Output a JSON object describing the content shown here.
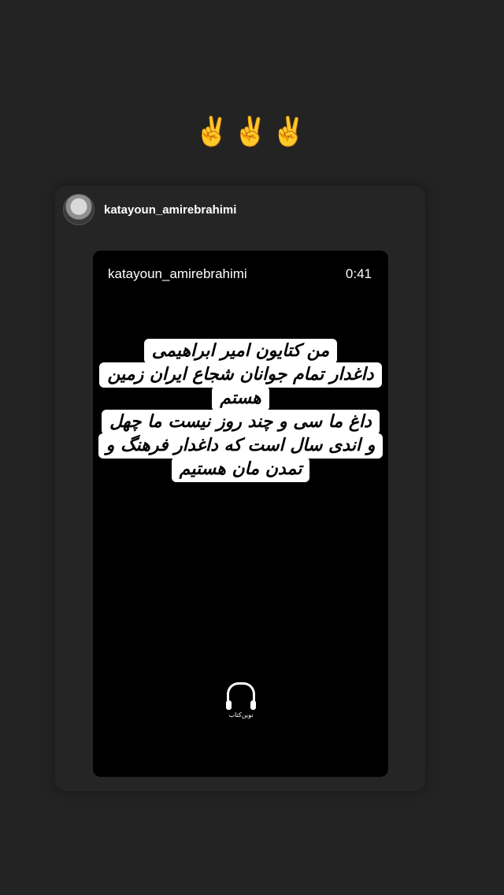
{
  "emoji": "✌️✌️✌️",
  "card": {
    "username": "katayoun_amirebrahimi",
    "avatar_icon": "profile-photo"
  },
  "story": {
    "username": "katayoun_amirebrahimi",
    "duration": "0:41",
    "caption_lines": [
      "من کتایون امیر ابراهیمی",
      "داغدار تمام جوانان شجاع ایران زمین",
      "هستم",
      "داغ ما سی و چند روز نیست ما چهل",
      "و اندی سال است که داغدار فرهنگ و",
      "تمدن مان هستیم"
    ],
    "logo_icon": "headphones-book-logo",
    "logo_text": "نوین‌کتاب"
  },
  "colors": {
    "background": "#232323",
    "card": "#252525",
    "story": "#000000",
    "caption_bg": "#ffffff",
    "text": "#ffffff"
  }
}
